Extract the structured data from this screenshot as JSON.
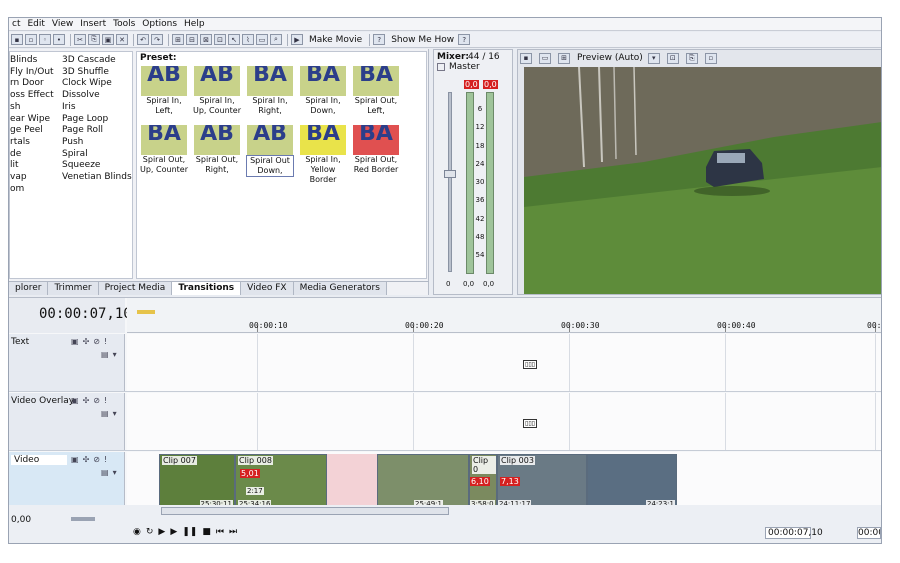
{
  "menubar": {
    "items": [
      "ct",
      "Edit",
      "View",
      "Insert",
      "Tools",
      "Options",
      "Help"
    ]
  },
  "toolbar": {
    "make_movie_label": "Make Movie",
    "show_me_how_label": "Show Me How"
  },
  "fx_list": {
    "col1": [
      "Blinds",
      "Fly In/Out",
      "rn Door",
      "oss Effect",
      "sh",
      "ear Wipe",
      "ge Peel",
      "rtals",
      "de",
      "lit",
      "vap",
      "om"
    ],
    "col2": [
      "3D Cascade",
      "3D Shuffle",
      "Clock Wipe",
      "Dissolve",
      "Iris",
      "Page Loop",
      "Page Roll",
      "Push",
      "Spiral",
      "Squeeze",
      "Venetian Blinds"
    ]
  },
  "preset": {
    "label": "Preset:",
    "thumbnails": [
      {
        "name": "Spiral In, Left,",
        "glyph": "AB"
      },
      {
        "name": "Spiral In, Up, Counter",
        "glyph": "AB"
      },
      {
        "name": "Spiral In, Right,",
        "glyph": "BA"
      },
      {
        "name": "Spiral In, Down,",
        "glyph": "BA"
      },
      {
        "name": "Spiral Out, Left,",
        "glyph": "BA"
      },
      {
        "name": "Spiral Out, Up, Counter",
        "glyph": "BA"
      },
      {
        "name": "Spiral Out, Right,",
        "glyph": "AB"
      },
      {
        "name": "Spiral Out Down,",
        "glyph": "AB"
      },
      {
        "name": "Spiral In, Yellow Border",
        "glyph": "BA"
      },
      {
        "name": "Spiral Out, Red Border",
        "glyph": "BA"
      }
    ]
  },
  "tabs": [
    "plorer",
    "Trimmer",
    "Project Media",
    "Transitions",
    "Video FX",
    "Media Generators"
  ],
  "active_tab": "Transitions",
  "mixer": {
    "title": "Mixer:",
    "rate": "44 / 16",
    "master_label": "Master",
    "peak_left": "0,0",
    "peak_right": "0,0",
    "scale": [
      "6",
      "12",
      "18",
      "24",
      "30",
      "36",
      "42",
      "48",
      "54"
    ],
    "bottom_left": "0",
    "bottom_mid": "0,0",
    "bottom_right": "0,0",
    "fader_label": "0,0"
  },
  "preview": {
    "label": "Preview (Auto)"
  },
  "timeline": {
    "timecode": "00:00:07,10",
    "ruler": [
      {
        "label": "00:00:10"
      },
      {
        "label": "00:00:20"
      },
      {
        "label": "00:00:30"
      },
      {
        "label": "00:00:40"
      },
      {
        "label": "00:0"
      }
    ],
    "tracks": [
      {
        "name": "Text"
      },
      {
        "name": "Video Overlay"
      },
      {
        "name": "Video"
      }
    ],
    "clips": [
      {
        "label": "Clip 007",
        "time": "25:30:11"
      },
      {
        "label": "Clip 008",
        "time": "25:34:16",
        "badge": "5,01",
        "badge2": "2:17"
      },
      {
        "label": "",
        "time": "25:49:1"
      },
      {
        "label": "Clip 0",
        "time": "3:58:0",
        "badge": "6,10"
      },
      {
        "label": "Clip 003",
        "time": "24:11:17",
        "badge": "7,13"
      },
      {
        "label": "",
        "time": "24:23:1"
      }
    ],
    "bottom_left_value": "0,00",
    "bottom_right_time": "00:00:07,10",
    "bottom_far_right": "00:00"
  },
  "colors": {
    "accent": "#2c3e8a",
    "peak_red": "#d52020",
    "meter_green": "#9fc49a",
    "video_track": "#d8e8f5"
  }
}
